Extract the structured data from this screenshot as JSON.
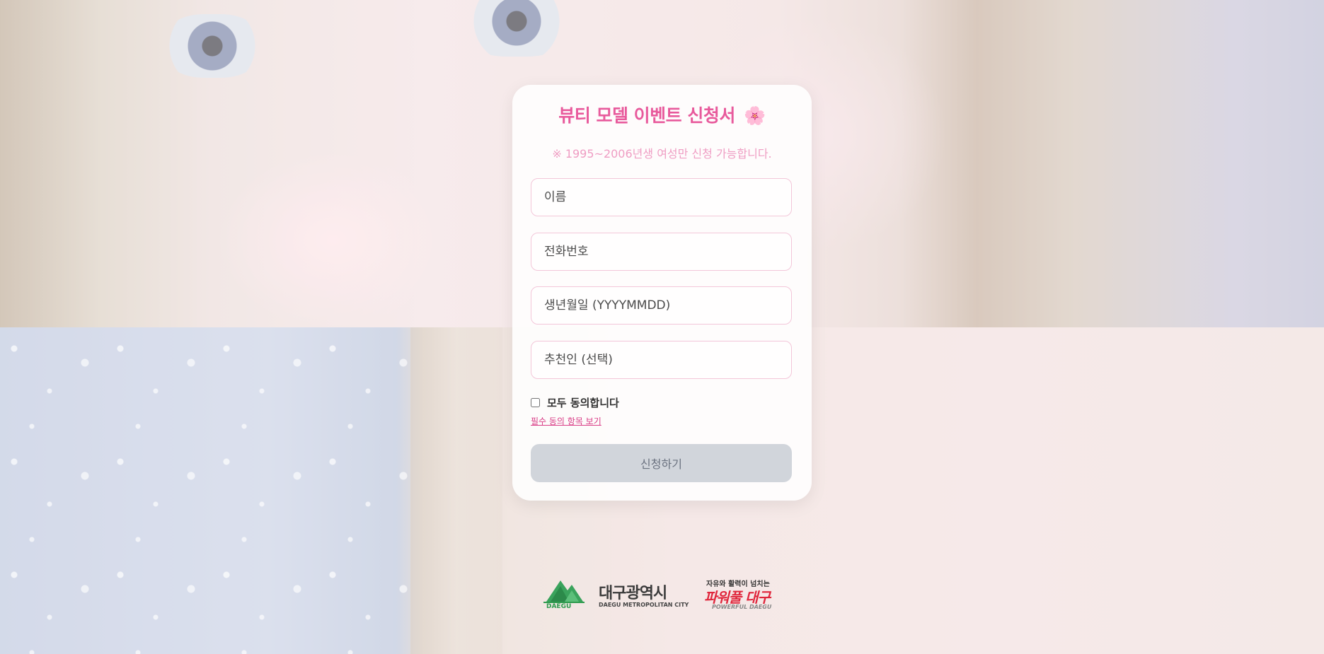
{
  "form": {
    "title": "뷰티 모델 이벤트 신청서",
    "title_icon": "🌸",
    "title_icon_name": "cherry-blossom-icon",
    "notice": "※ 1995~2006년생 여성만 신청 가능합니다.",
    "fields": {
      "name_placeholder": "이름",
      "phone_placeholder": "전화번호",
      "birth_placeholder": "생년월일 (YYYYMMDD)",
      "referrer_placeholder": "추천인 (선택)"
    },
    "agree_all_label": "모두 동의합니다",
    "agree_all_checked": false,
    "terms_link": "필수 동의 항목 보기",
    "submit_label": "신청하기"
  },
  "footer": {
    "daegu_mark_text": "DAEGU",
    "daegu_name_kr": "대구광역시",
    "daegu_name_en": "DAEGU METROPOLITAN CITY",
    "slogan_top": "자유와 활력이 넘치는",
    "slogan_main": "파워풀 대구",
    "slogan_en": "POWERFUL DAEGU"
  },
  "colors": {
    "accent_pink": "#e85a9c",
    "notice_pink": "#ef9dc3",
    "link_pink": "#d93c86",
    "button_disabled": "#d1d5db",
    "daegu_green": "#2e9b4e",
    "powerful_red": "#e0263c"
  }
}
